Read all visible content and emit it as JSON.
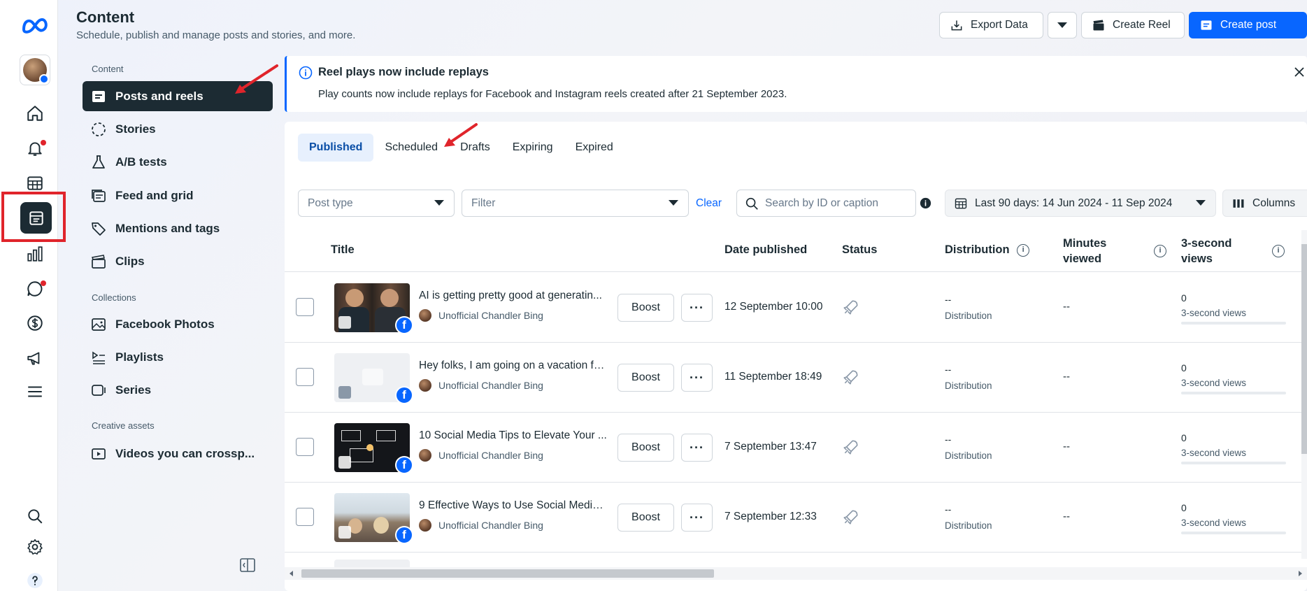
{
  "header": {
    "title": "Content",
    "subtitle": "Schedule, publish and manage posts and stories, and more.",
    "export_label": "Export Data",
    "create_reel_label": "Create Reel",
    "create_post_label": "Create post"
  },
  "nav": {
    "section_content": "Content",
    "section_collections": "Collections",
    "section_creative": "Creative assets",
    "items": [
      {
        "label": "Posts and reels"
      },
      {
        "label": "Stories"
      },
      {
        "label": "A/B tests"
      },
      {
        "label": "Feed and grid"
      },
      {
        "label": "Mentions and tags"
      },
      {
        "label": "Clips"
      },
      {
        "label": "Facebook Photos"
      },
      {
        "label": "Playlists"
      },
      {
        "label": "Series"
      },
      {
        "label": "Videos you can crossp..."
      }
    ]
  },
  "banner": {
    "title": "Reel plays now include replays",
    "text": "Play counts now include replays for Facebook and Instagram reels created after 21 September 2023."
  },
  "tabs": [
    {
      "label": "Published"
    },
    {
      "label": "Scheduled"
    },
    {
      "label": "Drafts"
    },
    {
      "label": "Expiring"
    },
    {
      "label": "Expired"
    }
  ],
  "filters": {
    "post_type_placeholder": "Post type",
    "filter_placeholder": "Filter",
    "clear_label": "Clear",
    "search_placeholder": "Search by ID or caption",
    "date_range": "Last 90 days: 14 Jun 2024 - 11 Sep 2024",
    "columns_label": "Columns"
  },
  "table": {
    "headers": {
      "title": "Title",
      "date": "Date published",
      "status": "Status",
      "distribution": "Distribution",
      "minutes_1": "Minutes",
      "minutes_2": "viewed",
      "views_1": "3-second",
      "views_2": "views"
    },
    "boost_label": "Boost",
    "more_label": "···",
    "rows": [
      {
        "title": "AI is getting pretty good at generatin...",
        "author": "Unofficial Chandler Bing",
        "date": "12 September 10:00",
        "distribution": "--",
        "distribution_label": "Distribution",
        "minutes": "--",
        "views": "0",
        "views_label": "3-second views"
      },
      {
        "title": "Hey folks, I am going on a vacation fo...",
        "author": "Unofficial Chandler Bing",
        "date": "11 September 18:49",
        "distribution": "--",
        "distribution_label": "Distribution",
        "minutes": "--",
        "views": "0",
        "views_label": "3-second views"
      },
      {
        "title": "10 Social Media Tips to Elevate Your ...",
        "author": "Unofficial Chandler Bing",
        "date": "7 September 13:47",
        "distribution": "--",
        "distribution_label": "Distribution",
        "minutes": "--",
        "views": "0",
        "views_label": "3-second views"
      },
      {
        "title": "9 Effective Ways to Use Social Media t...",
        "author": "Unofficial Chandler Bing",
        "date": "7 September 12:33",
        "distribution": "--",
        "distribution_label": "Distribution",
        "minutes": "--",
        "views": "0",
        "views_label": "3-second views"
      }
    ]
  },
  "colors": {
    "accent": "#0866ff",
    "dark": "#1c2b33",
    "annotation_red": "#e0242b"
  }
}
